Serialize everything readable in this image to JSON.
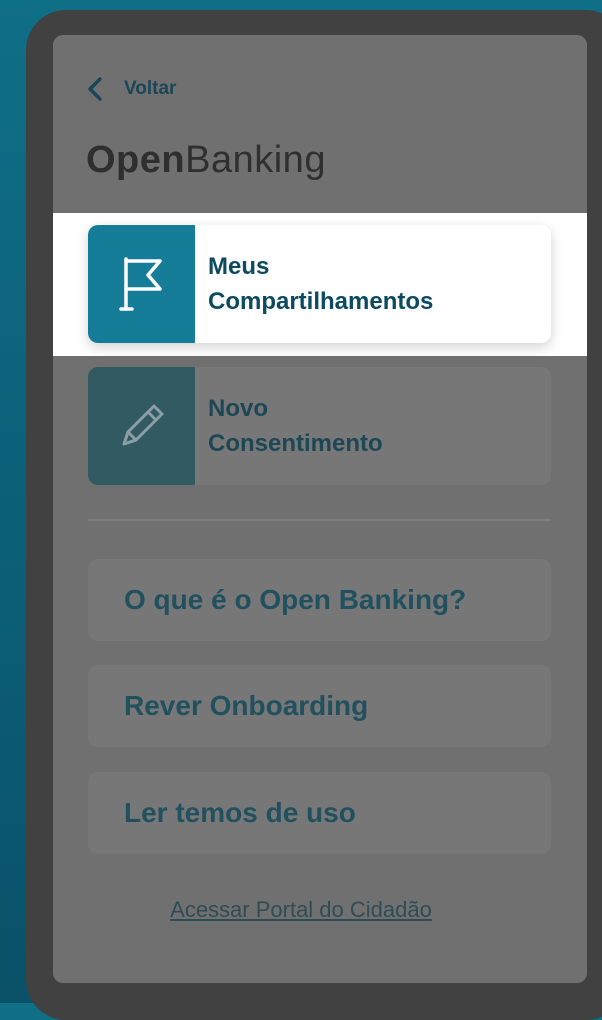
{
  "header": {
    "back_label": "Voltar",
    "logo_bold": "Open",
    "logo_light": "Banking"
  },
  "menu": {
    "cards": [
      {
        "line1": "Meus",
        "line2": "Compartilhamentos",
        "icon": "flag-icon"
      },
      {
        "line1": "Novo",
        "line2": "Consentimento",
        "icon": "pencil-icon"
      }
    ],
    "links": [
      "O que é o Open Banking?",
      "Rever Onboarding",
      "Ler temos de uso"
    ]
  },
  "footer": {
    "portal_link": "Acessar Portal do Cidadão"
  },
  "colors": {
    "background": "#0f6f86",
    "overlay_screen": "#707070",
    "accent": "#167d99",
    "highlight": "#ffffff"
  }
}
